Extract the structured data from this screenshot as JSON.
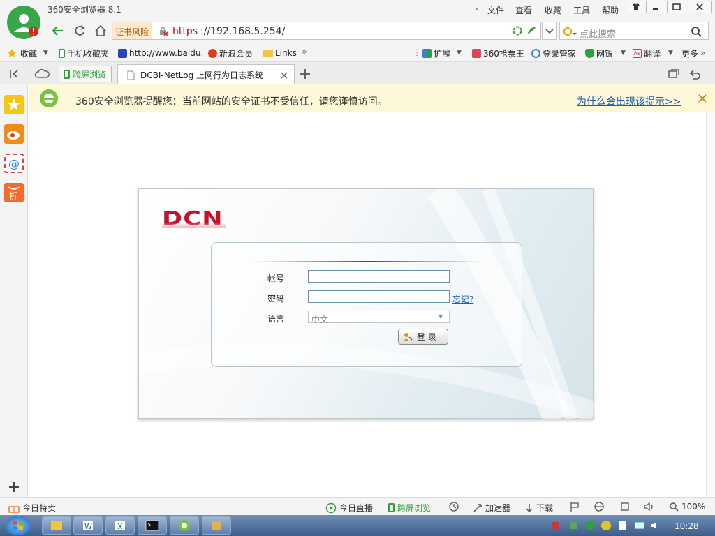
{
  "titlebar": {
    "title": "360安全浏览器 8.1",
    "menu": [
      "文件",
      "查看",
      "收藏",
      "工具",
      "帮助"
    ]
  },
  "addressbar": {
    "cert_warning": "证书风险",
    "url_scheme": "https",
    "url_rest": "://192.168.5.254/",
    "search_placeholder": "点此搜索"
  },
  "favorites": {
    "collect_label": "收藏",
    "items": [
      {
        "label": "手机收藏夹",
        "icon": "phone-icon"
      },
      {
        "label": "http://www.baidu.",
        "icon": "baidu-paw-icon"
      },
      {
        "label": "新浪会员",
        "icon": "weibo-icon"
      },
      {
        "label": "Links",
        "icon": "folder-icon"
      }
    ],
    "tools": [
      {
        "label": "扩展",
        "icon": "extension-icon"
      },
      {
        "label": "360抢票王",
        "icon": "ticket-icon"
      },
      {
        "label": "登录管家",
        "icon": "login-manager-icon"
      },
      {
        "label": "网银",
        "icon": "bank-shield-icon"
      },
      {
        "label": "翻译",
        "icon": "translate-icon"
      },
      {
        "label": "更多",
        "icon": "more-icon"
      }
    ]
  },
  "tabs": {
    "screen_label": "跨屏浏览",
    "active_tab": "DCBI-NetLog 上网行为日志系统"
  },
  "warning": {
    "message": "360安全浏览器提醒您：当前网站的安全证书不受信任，请您谨慎访问。",
    "link": "为什么会出现该提示>>"
  },
  "login": {
    "logo": "DCN",
    "account_label": "帐号",
    "account_value": "",
    "password_label": "密码",
    "password_value": "",
    "forgot_link": "忘记?",
    "language_label": "语言",
    "language_selected": "中文",
    "login_button": "登 录"
  },
  "statusbar": {
    "left_label": "今日特卖",
    "items": [
      "今日直播",
      "跨屏浏览",
      "加速器",
      "下载"
    ],
    "zoom": "100%"
  },
  "taskbar": {
    "clock": "10:28"
  },
  "colors": {
    "accent_green": "#2f9f3a",
    "warning_bg": "#fdf8d8",
    "link_blue": "#1a5fb4",
    "dcn_red": "#c8102e"
  }
}
